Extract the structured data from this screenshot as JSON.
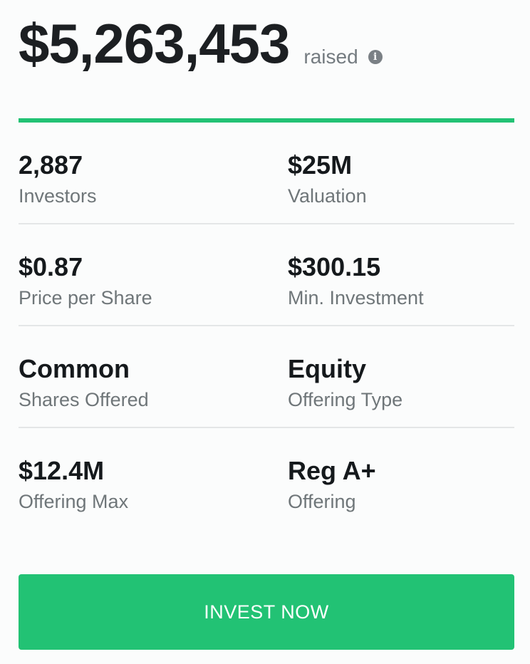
{
  "raised": {
    "amount": "$5,263,453",
    "label": "raised",
    "info_icon": "info-circle-icon"
  },
  "progress": {
    "fraction": 1.0,
    "color": "#22c274"
  },
  "stats": [
    [
      {
        "value": "2,887",
        "label": "Investors"
      },
      {
        "value": "$25M",
        "label": "Valuation"
      }
    ],
    [
      {
        "value": "$0.87",
        "label": "Price per Share"
      },
      {
        "value": "$300.15",
        "label": "Min. Investment"
      }
    ],
    [
      {
        "value": "Common",
        "label": "Shares Offered"
      },
      {
        "value": "Equity",
        "label": "Offering Type"
      }
    ],
    [
      {
        "value": "$12.4M",
        "label": "Offering Max"
      },
      {
        "value": "Reg A+",
        "label": "Offering"
      }
    ]
  ],
  "cta": {
    "label": "INVEST NOW",
    "color": "#22c274"
  }
}
